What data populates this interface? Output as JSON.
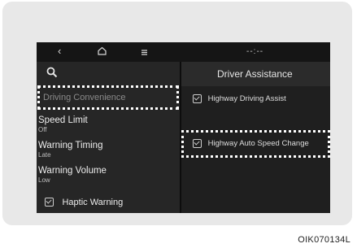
{
  "topbar": {
    "back_icon": "chevron-left-icon",
    "home_icon": "home-icon",
    "menu_icon": "menu-icon",
    "clock": "--:--"
  },
  "left": {
    "search_icon": "search-icon",
    "selected_item": "Driving Convenience",
    "items": [
      {
        "label": "Speed Limit",
        "value": "Off"
      },
      {
        "label": "Warning Timing",
        "value": "Late"
      },
      {
        "label": "Warning Volume",
        "value": "Low"
      }
    ],
    "haptic": {
      "label": "Haptic Warning",
      "checked": true
    }
  },
  "right": {
    "title": "Driver Assistance",
    "options": [
      {
        "label": "Highway Driving Assist",
        "checked": true
      },
      {
        "label": "Highway Auto Speed Change",
        "checked": true
      }
    ]
  },
  "caption": "OIK070134L"
}
